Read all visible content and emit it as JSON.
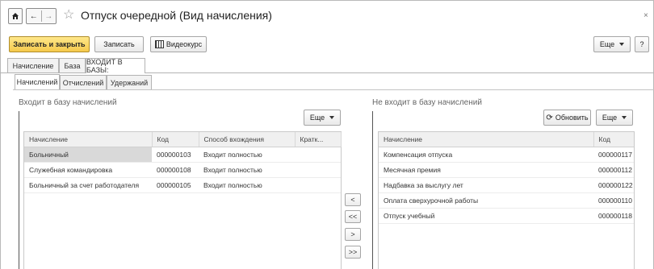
{
  "window": {
    "title": "Отпуск очередной (Вид начисления)",
    "close_glyph": "×"
  },
  "toolbar": {
    "save_close": "Записать и закрыть",
    "save": "Записать",
    "video": "Видеокурс",
    "more": "Еще",
    "help": "?"
  },
  "tabs": [
    "Начисление",
    "База",
    "ВХОДИТ В БАЗЫ:"
  ],
  "subtabs": [
    "Начислений",
    "Отчислений",
    "Удержаний"
  ],
  "left": {
    "title": "Входит в базу начислений",
    "more": "Еще",
    "columns": [
      "Начисление",
      "Код",
      "Способ вхождения",
      "Кратк..."
    ],
    "rows": [
      [
        "Больничный",
        "000000103",
        "Входит полностью",
        ""
      ],
      [
        "Служебная командировка",
        "000000108",
        "Входит полностью",
        ""
      ],
      [
        "Больничный за счет работодателя",
        "000000105",
        "Входит полностью",
        ""
      ]
    ]
  },
  "right": {
    "title": "Не входит в базу начислений",
    "refresh": "Обновить",
    "more": "Еще",
    "columns": [
      "Начисление",
      "Код"
    ],
    "rows": [
      [
        "Компенсация отпуска",
        "000000117"
      ],
      [
        "Месячная премия",
        "000000112"
      ],
      [
        "Надбавка за выслугу лет",
        "000000122"
      ],
      [
        "Оплата сверхурочной работы",
        "000000110"
      ],
      [
        "Отпуск учебный",
        "000000118"
      ]
    ]
  },
  "move_buttons": [
    "<",
    "<<",
    ">",
    ">>"
  ]
}
